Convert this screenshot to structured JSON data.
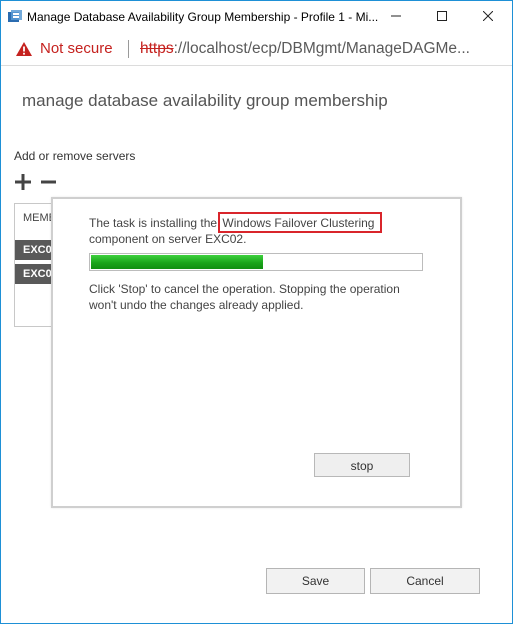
{
  "window": {
    "title": "Manage Database Availability Group Membership - Profile 1 - Mi..."
  },
  "address_bar": {
    "security_label": "Not secure",
    "scheme": "https",
    "url_rest": "://localhost/ecp/DBMgmt/ManageDAGMe..."
  },
  "page": {
    "title": "manage database availability group membership",
    "section_label": "Add or remove servers"
  },
  "members": {
    "header": "MEMBE",
    "rows": [
      "EXC0",
      "EXC0"
    ]
  },
  "dialog": {
    "task_prefix": "The task is installing the ",
    "task_highlight": "Windows Failover Clustering",
    "task_suffix": "component on server EXC02.",
    "progress": 0.52,
    "hint": "Click 'Stop' to cancel the operation. Stopping the operation won't undo the changes already applied.",
    "stop_label": "stop"
  },
  "footer": {
    "save_label": "Save",
    "cancel_label": "Cancel"
  },
  "colors": {
    "insecure": "#c5221f",
    "progress_green": "#1aa51a",
    "highlight_border": "#d9252b"
  }
}
